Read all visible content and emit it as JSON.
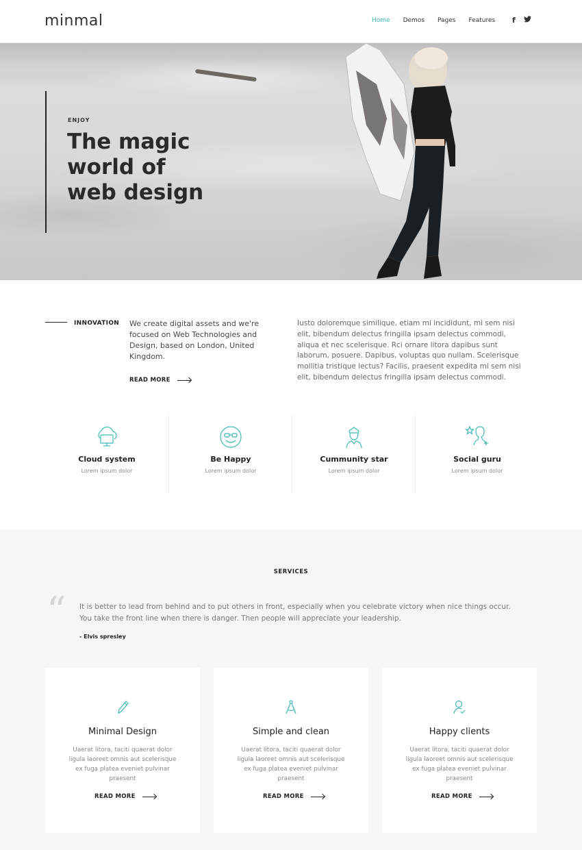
{
  "header": {
    "logo": "minmal",
    "nav": [
      "Home",
      "Demos",
      "Pages",
      "Features"
    ],
    "active_nav": "Home",
    "social": [
      "f",
      "t"
    ]
  },
  "hero": {
    "kicker": "ENJOY",
    "title_lines": [
      "The magic",
      "world of",
      "web design"
    ]
  },
  "innovation": {
    "label": "INNOVATION",
    "text_lines": [
      "We create digital assets and we're",
      "focused on Web Technologies and",
      "Design, based on London, United",
      "Kingdom."
    ],
    "read_more": "READ MORE",
    "paragraph_lines": [
      "Iusto doloremque similique, etiam mi incididunt, mi sem nisi",
      "elit, bibendum delectus fringilla ipsam delectus commodi,",
      "aliqua et nec scelerisque. Rci ornare litora dapibus sunt",
      "laborum, posuere. Dapibus, voluptas quo nullam. Scelerisque",
      "mollitia tristique lectus? Facilis, praesent expedita mi sem nisi",
      "elit, bibendum delectus fringilla ipsam delectus commodi."
    ]
  },
  "features": [
    {
      "title": "Cloud system",
      "subtitle": "Lorem ipsum dolor",
      "icon": "cloud-monitor-icon"
    },
    {
      "title": "Be Happy",
      "subtitle": "Lorem ipsum dolor",
      "icon": "smiley-glasses-icon"
    },
    {
      "title": "Cummunity star",
      "subtitle": "Lorem ipsum dolor",
      "icon": "police-person-icon"
    },
    {
      "title": "Social guru",
      "subtitle": "Lorem ipsum dolor",
      "icon": "star-person-icon"
    }
  ],
  "services": {
    "heading": "SERVICES",
    "quote_lines": [
      "It is better to lead from behind and to put others in front, especially when you celebrate victory when nice things occur.",
      "You take the front line when there is danger. Then people will appreciate your leadership."
    ],
    "author": "- Elvis spresley",
    "cards": [
      {
        "title": "Minimal Design",
        "icon": "pencil-icon",
        "desc_lines": [
          "Uaerat litora, taciti quaerat dolor",
          "ligula laoreet omnis aut scelerisque",
          "ex fuga platea eveniet pulvinar",
          "praesent"
        ],
        "read_more": "READ MORE"
      },
      {
        "title": "Simple and clean",
        "icon": "compass-icon",
        "desc_lines": [
          "Uaerat litora, taciti quaerat dolor",
          "ligula laoreet omnis aut scelerisque",
          "ex fuga platea eveniet pulvinar",
          "praesent"
        ],
        "read_more": "READ MORE"
      },
      {
        "title": "Happy clients",
        "icon": "user-check-icon",
        "desc_lines": [
          "Uaerat litora, taciti quaerat dolor",
          "ligula laoreet omnis aut scelerisque",
          "ex fuga platea eveniet pulvinar",
          "praesent"
        ],
        "read_more": "READ MORE"
      }
    ]
  },
  "colors": {
    "accent": "#3fb9b6",
    "services_bg": "#f4f7f6",
    "dark_text": "#222222"
  }
}
